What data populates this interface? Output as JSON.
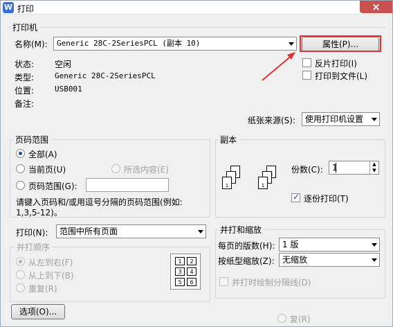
{
  "window": {
    "title": "打印",
    "close": "×"
  },
  "printer": {
    "group_title": "打印机",
    "name_label": "名称(M):",
    "name_value": "Generic 28C-2SeriesPCL (副本 10)",
    "properties_button": "属性(P)...",
    "status_label": "状态:",
    "status_value": "空闲",
    "type_label": "类型:",
    "type_value": "Generic 28C-2SeriesPCL",
    "location_label": "位置:",
    "location_value": "USB001",
    "comment_label": "备注:",
    "reverse_print": "反片打印(I)",
    "print_to_file": "打印到文件(L)",
    "paper_source_label": "纸张来源(S):",
    "paper_source_value": "使用打印机设置"
  },
  "page_range": {
    "group_title": "页码范围",
    "all": "全部(A)",
    "current": "当前页(U)",
    "selection": "所选内容(E)",
    "pages": "页码范围(G):",
    "hint": "请键入页码和/或用逗号分隔的页码范围(例如:",
    "hint2": "1,3,5-12)。"
  },
  "copies": {
    "group_title": "副本",
    "count_label": "份数(C):",
    "count_value": "1",
    "collate": "逐份打印(T)"
  },
  "print_what": {
    "label": "打印(N):",
    "value": "范围中所有页面",
    "order_title": "并打顺序",
    "left_to_right": "从左到右(F)",
    "top_to_bottom": "从上到下(B)",
    "repeat": "重复(R)",
    "layout_nums": [
      "1",
      "2",
      "3",
      "4",
      "5",
      "6"
    ]
  },
  "zoom": {
    "group_title": "并打和缩放",
    "pages_per_sheet_label": "每页的版数(H):",
    "pages_per_sheet_value": "1 版",
    "scale_label": "按纸型缩放(Z):",
    "scale_value": "无缩放",
    "draw_borders": "并打时绘制分隔线(D)"
  },
  "options_button": "选项(O)...",
  "partial_bottom": "复(R)"
}
